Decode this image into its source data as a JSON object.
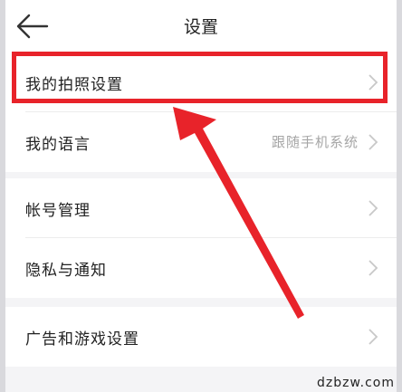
{
  "header": {
    "title": "设置",
    "back_icon": "arrow-left-icon"
  },
  "groups": [
    {
      "items": [
        {
          "label": "我的拍照设置",
          "value": ""
        },
        {
          "label": "我的语言",
          "value": "跟随手机系统"
        }
      ]
    },
    {
      "items": [
        {
          "label": "帐号管理",
          "value": ""
        },
        {
          "label": "隐私与通知",
          "value": ""
        }
      ]
    },
    {
      "items": [
        {
          "label": "广告和游戏设置",
          "value": ""
        }
      ]
    }
  ],
  "annotation": {
    "color": "#e8232a",
    "target": "我的拍照设置"
  },
  "watermark": "dzbzw.com"
}
